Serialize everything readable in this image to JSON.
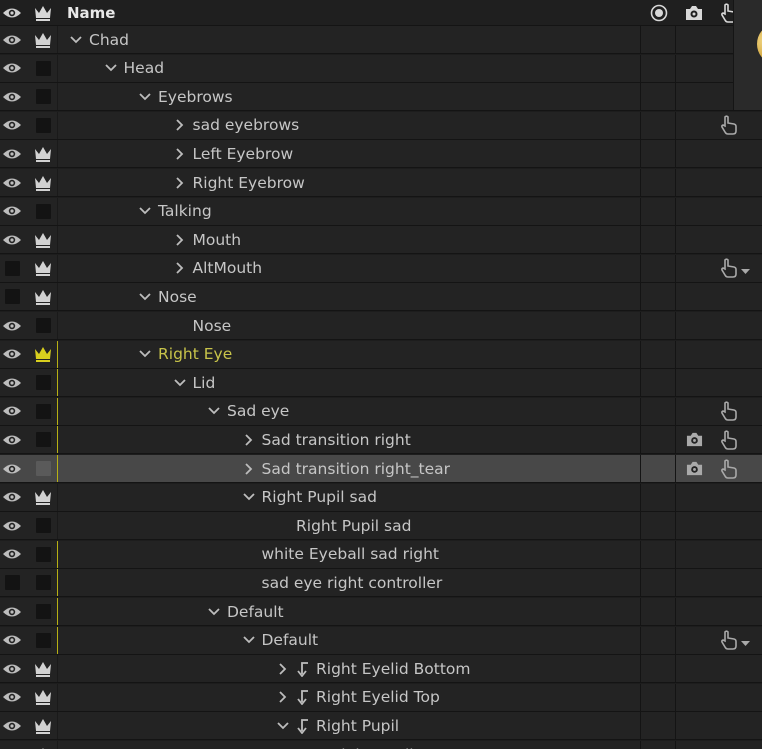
{
  "header": {
    "name_label": "Name"
  },
  "colors": {
    "accent_yellow": "#c8c44a",
    "row_background": "#232323",
    "selected_row": "#484848"
  },
  "layers": [
    {
      "label": "Chad",
      "depth": 0,
      "expander": "down",
      "eye": true,
      "crown": true
    },
    {
      "label": "Head",
      "depth": 1,
      "expander": "down",
      "eye": true,
      "crown": false
    },
    {
      "label": "Eyebrows",
      "depth": 2,
      "expander": "down",
      "eye": true,
      "crown": false
    },
    {
      "label": "sad eyebrows",
      "depth": 3,
      "expander": "right",
      "eye": true,
      "crown": false,
      "touch": "hand"
    },
    {
      "label": "Left Eyebrow",
      "depth": 3,
      "expander": "right",
      "eye": true,
      "crown": true
    },
    {
      "label": "Right Eyebrow",
      "depth": 3,
      "expander": "right",
      "eye": true,
      "crown": true
    },
    {
      "label": "Talking",
      "depth": 2,
      "expander": "down",
      "eye": true,
      "crown": false
    },
    {
      "label": "Mouth",
      "depth": 3,
      "expander": "right",
      "eye": true,
      "crown": true
    },
    {
      "label": "AltMouth",
      "depth": 3,
      "expander": "right",
      "eye": false,
      "crown": true,
      "touch": "hand-dropdown"
    },
    {
      "label": "Nose",
      "depth": 2,
      "expander": "down",
      "eye": false,
      "crown": true
    },
    {
      "label": "Nose",
      "depth": 3,
      "expander": "none",
      "eye": true,
      "crown": false
    },
    {
      "label": "Right Eye",
      "depth": 2,
      "expander": "down",
      "eye": true,
      "crown": true,
      "crown_yellow": true,
      "label_yellow": true,
      "mark": "yellow"
    },
    {
      "label": "Lid",
      "depth": 3,
      "expander": "down",
      "eye": true,
      "crown": false,
      "mark": "yellow"
    },
    {
      "label": "Sad eye",
      "depth": 4,
      "expander": "down",
      "eye": true,
      "crown": false,
      "mark": "yellow",
      "touch": "hand"
    },
    {
      "label": "Sad transition right",
      "depth": 5,
      "expander": "right",
      "eye": true,
      "crown": false,
      "mark": "yellow",
      "camera": true,
      "touch": "hand"
    },
    {
      "label": "Sad transition right_tear",
      "depth": 5,
      "expander": "right",
      "eye": true,
      "crown": false,
      "mark": "yellow",
      "camera": true,
      "touch": "hand",
      "selected": true
    },
    {
      "label": "Right Pupil sad",
      "depth": 5,
      "expander": "down",
      "eye": true,
      "crown": true
    },
    {
      "label": "Right Pupil sad",
      "depth": 6,
      "expander": "none",
      "eye": true,
      "crown": false
    },
    {
      "label": "white Eyeball sad right",
      "depth": 5,
      "expander": "none",
      "eye": true,
      "crown": false,
      "mark": "yellow"
    },
    {
      "label": "sad eye right controller",
      "depth": 5,
      "expander": "none",
      "eye": false,
      "crown": false,
      "mark": "yellow"
    },
    {
      "label": "Default",
      "depth": 4,
      "expander": "down",
      "eye": true,
      "crown": false,
      "mark": "yellow"
    },
    {
      "label": "Default",
      "depth": 5,
      "expander": "down",
      "eye": true,
      "crown": false,
      "mark": "yellow",
      "touch": "hand-dropdown"
    },
    {
      "label": "Right Eyelid Bottom",
      "depth": 6,
      "expander": "right",
      "eye": true,
      "crown": true,
      "ik": true
    },
    {
      "label": "Right Eyelid Top",
      "depth": 6,
      "expander": "right",
      "eye": true,
      "crown": true,
      "ik": true
    },
    {
      "label": "Right Pupil",
      "depth": 6,
      "expander": "down",
      "eye": true,
      "crown": true,
      "ik": true
    },
    {
      "label": "Right Pupil",
      "depth": 7,
      "expander": "none",
      "eye": true,
      "crown": true
    }
  ]
}
